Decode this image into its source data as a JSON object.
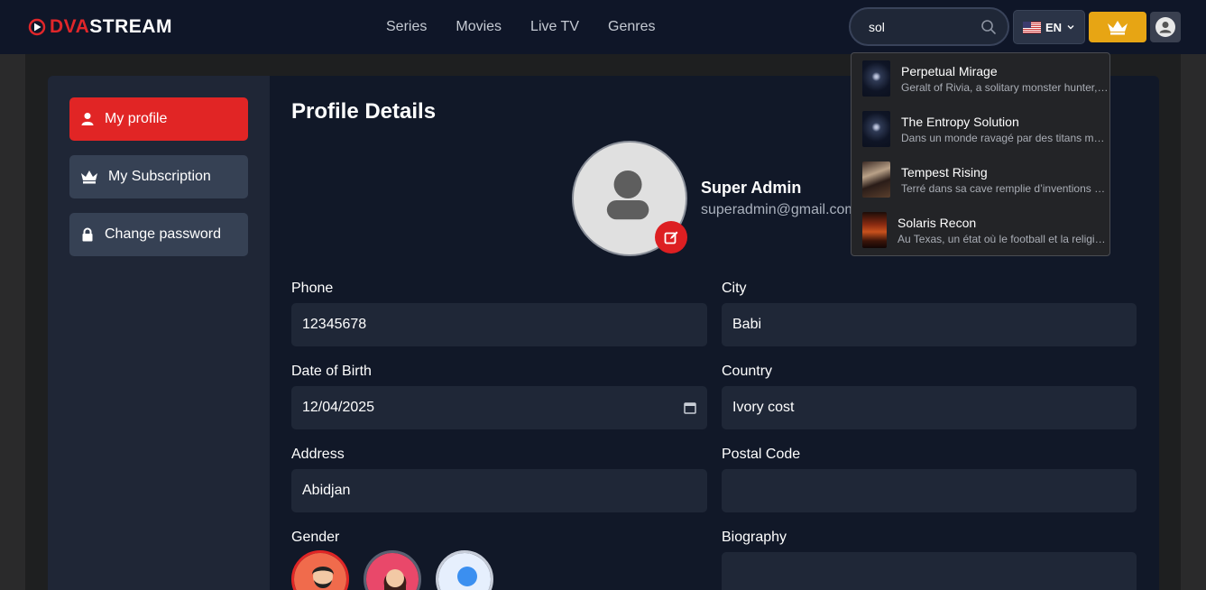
{
  "brand": {
    "name_red": "DVA",
    "name_white": "STREAM"
  },
  "nav": {
    "items": [
      "Series",
      "Movies",
      "Live TV",
      "Genres"
    ]
  },
  "search": {
    "value": "sol"
  },
  "language": {
    "code": "EN"
  },
  "search_results": [
    {
      "title": "Perpetual Mirage",
      "description": "Geralt of Rivia, a solitary monster hunter, s..."
    },
    {
      "title": "The Entropy Solution",
      "description": "Dans un monde ravagé par des titans man..."
    },
    {
      "title": "Tempest Rising",
      "description": "Terré dans sa cave remplie d’inventions et..."
    },
    {
      "title": "Solaris Recon",
      "description": "Au Texas, un état où le football et la religio..."
    }
  ],
  "sidebar": {
    "items": [
      {
        "label": "My profile",
        "icon": "user-icon",
        "active": true
      },
      {
        "label": "My Subscription",
        "icon": "crown-icon",
        "active": false
      },
      {
        "label": "Change password",
        "icon": "lock-icon",
        "active": false
      }
    ]
  },
  "profile": {
    "title": "Profile Details",
    "name": "Super Admin",
    "email": "superadmin@gmail.com"
  },
  "form": {
    "phone": {
      "label": "Phone",
      "value": "12345678"
    },
    "city": {
      "label": "City",
      "value": "Babi"
    },
    "dob": {
      "label": "Date of Birth",
      "value": "12/04/2025"
    },
    "country": {
      "label": "Country",
      "value": "Ivory cost"
    },
    "address": {
      "label": "Address",
      "value": "Abidjan"
    },
    "postal": {
      "label": "Postal Code",
      "value": ""
    },
    "gender": {
      "label": "Gender",
      "options": [
        "male-avatar",
        "female-avatar",
        "neutral-avatar"
      ],
      "selected": "male-avatar"
    },
    "biography": {
      "label": "Biography",
      "value": ""
    }
  },
  "colors": {
    "accent": "#e12525",
    "premium": "#e7a514",
    "background": "#111828"
  }
}
